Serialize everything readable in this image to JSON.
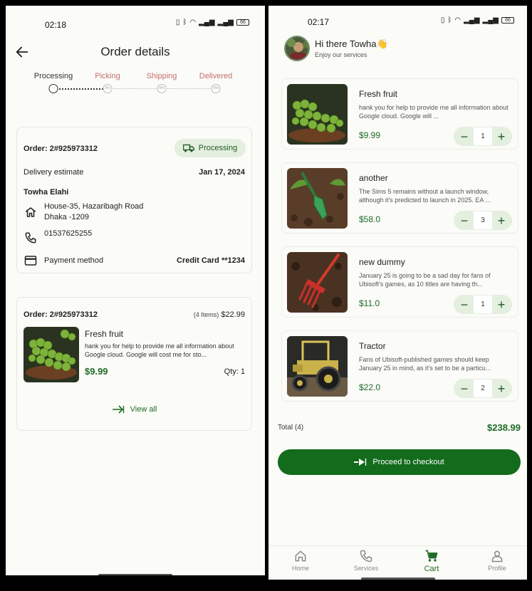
{
  "left_screen": {
    "status": {
      "time": "02:18",
      "battery": "66"
    },
    "title": "Order details",
    "steps": [
      {
        "label": "Processing",
        "color": "#333333"
      },
      {
        "label": "Picking",
        "color": "#c0706c"
      },
      {
        "label": "Shipping",
        "color": "#c0706c"
      },
      {
        "label": "Delivered",
        "color": "#c0706c"
      }
    ],
    "step_dot_glyphs": [
      "···",
      "0%",
      "0%",
      "0%"
    ],
    "order": {
      "number": "Order: 2#925973312",
      "status": "Processing",
      "delivery_label": "Delivery estimate",
      "delivery_date": "Jan 17, 2024",
      "customer_name": "Towha Elahi",
      "address_line1": "House-35, Hazaribagh Road",
      "address_line2": "Dhaka -1209",
      "phone": "01537625255",
      "payment_label": "Payment method",
      "payment_value": "Credit Card **1234"
    },
    "items_card": {
      "number": "Order: 2#925973312",
      "summary": "(4 Items)",
      "total": "$22.99",
      "item": {
        "title": "Fresh fruit",
        "desc": "hank you for help to provide me all information about Google cloud.  Google will cost me for sto...",
        "price": "$9.99",
        "qty": "Qty: 1"
      },
      "view_all": "View all"
    }
  },
  "right_screen": {
    "status": {
      "time": "02:17",
      "battery": "66"
    },
    "greeting": "Hi there Towha",
    "greeting_emoji": "👋",
    "subtitle": "Enjoy our services",
    "items": [
      {
        "title": "Fresh fruit",
        "desc": "hank you for help to provide me all information about Google cloud.  Google will ...",
        "price": "$9.99",
        "qty": "1"
      },
      {
        "title": "another",
        "desc": "The Sims 5 remains without a launch window, although it's predicted to launch in 2025. EA ...",
        "price": "$58.0",
        "qty": "3"
      },
      {
        "title": "new dummy",
        "desc": "January 25 is going to be a sad day for fans of Ubisoft's games, as 10 titles are having th...",
        "price": "$11.0",
        "qty": "1"
      },
      {
        "title": "Tractor",
        "desc": "Fans of Ubisoft-published games should keep January 25 in mind, as it's set to be a particu...",
        "price": "$22.0",
        "qty": "2"
      }
    ],
    "total_label": "Total (4)",
    "total_value": "$238.99",
    "checkout_label": "Proceed to checkout",
    "nav": [
      {
        "label": "Home",
        "icon": "home-icon"
      },
      {
        "label": "Services",
        "icon": "phone-icon"
      },
      {
        "label": "Cart",
        "icon": "cart-icon"
      },
      {
        "label": "Profile",
        "icon": "profile-icon"
      }
    ]
  },
  "colors": {
    "accent": "#136b1c",
    "chip_bg": "#e4efdf",
    "pending_step": "#c0706c"
  }
}
